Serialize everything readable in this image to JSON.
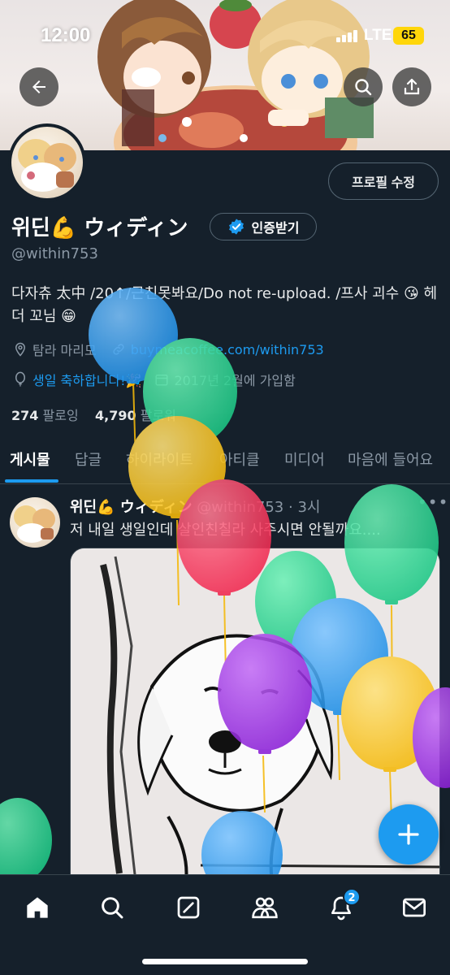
{
  "status_bar": {
    "time": "12:00",
    "network": "LTE",
    "battery": "65"
  },
  "profile": {
    "edit_button": "프로필 수정",
    "display_name": "위딘💪 ウィディン",
    "verify_button": "인증받기",
    "handle": "@within753",
    "bio": "다자츄 太中 /20↑/근친못봐요/Do not re-upload. /프사 괴수 😘 헤더 꼬님 😁",
    "location": "탐라 마리모",
    "website": "buymeacoffee.com/within753",
    "birthday": "생일 축하합니다!🎉",
    "joined": "2017년 2월에 가입함",
    "following_count": "274",
    "following_label": "팔로잉",
    "followers_count": "4,790",
    "followers_label": "팔로워"
  },
  "tabs": [
    "게시물",
    "답글",
    "하이라이트",
    "아티클",
    "미디어",
    "마음에 들어요"
  ],
  "post": {
    "name": "위딘💪 ウィディン",
    "handle": "@within753",
    "time": "3시",
    "separator": "·",
    "text": "저 내일 생일인데 살인친칠라 사주시면 안될까요...."
  },
  "nav": {
    "notifications_badge": "2"
  },
  "colors": {
    "accent": "#1d9bf0",
    "background": "#15202b",
    "muted": "#8b98a5",
    "border": "#38444d"
  },
  "icons": [
    "back-arrow-icon",
    "search-icon",
    "share-icon",
    "verified-check-icon",
    "location-icon",
    "link-icon",
    "balloon-icon",
    "home-icon",
    "compose-icon",
    "communities-icon",
    "bell-icon",
    "mail-icon",
    "plus-icon"
  ]
}
